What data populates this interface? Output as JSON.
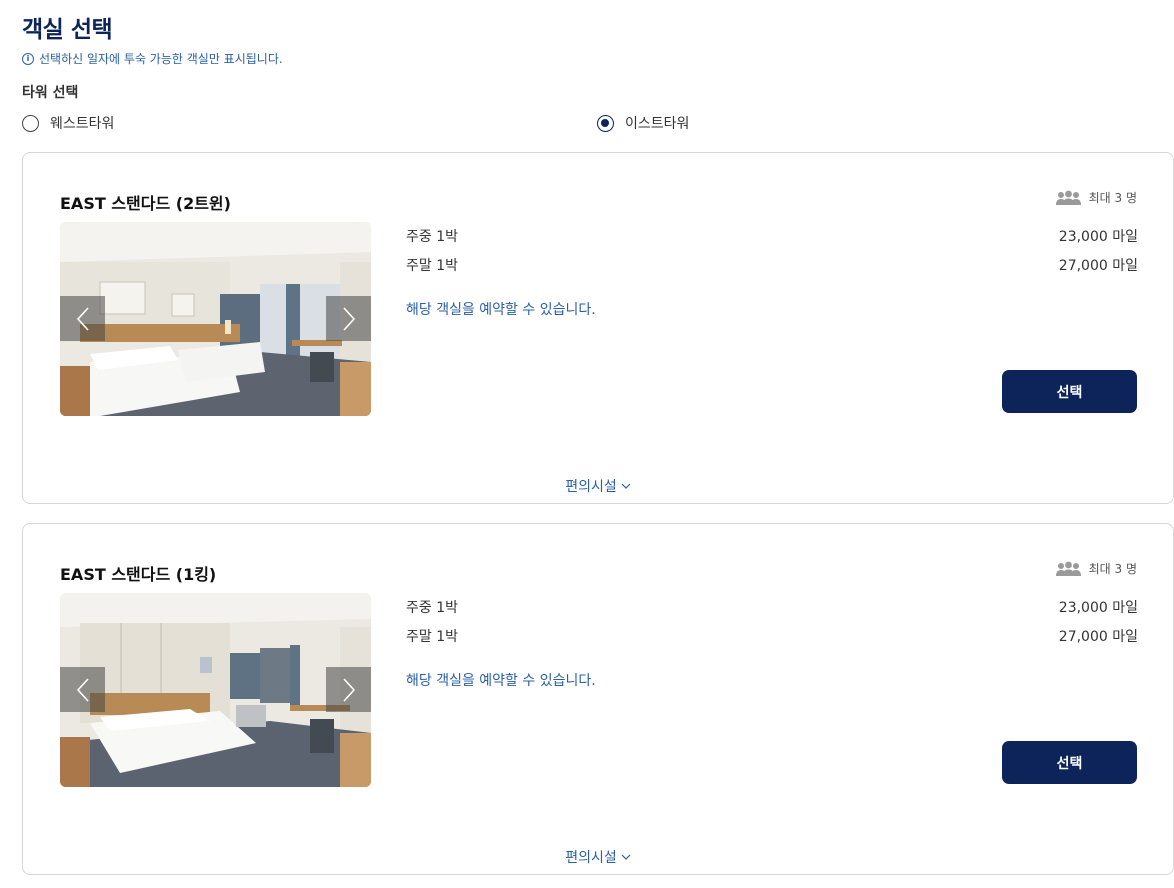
{
  "page": {
    "title": "객실 선택",
    "notice": "선택하신 일자에 투숙 가능한 객실만 표시됩니다.",
    "tower_label": "타워 선택",
    "info_icon_glyph": "i"
  },
  "towers": [
    {
      "label": "웨스트타워",
      "selected": false
    },
    {
      "label": "이스트타워",
      "selected": true
    }
  ],
  "rooms": [
    {
      "name": "EAST 스탠다드 (2트윈)",
      "capacity": "최대 3 명",
      "weekday_label": "주중 1박",
      "weekday_price": "23,000 마일",
      "weekend_label": "주말 1박",
      "weekend_price": "27,000 마일",
      "availability": "해당 객실을 예약할 수 있습니다.",
      "select_label": "선택",
      "amenities_label": "편의시설",
      "image": "twin-bed-hotel-room-photo"
    },
    {
      "name": "EAST 스탠다드 (1킹)",
      "capacity": "최대 3 명",
      "weekday_label": "주중 1박",
      "weekday_price": "23,000 마일",
      "weekend_label": "주말 1박",
      "weekend_price": "27,000 마일",
      "availability": "해당 객실을 예약할 수 있습니다.",
      "select_label": "선택",
      "amenities_label": "편의시설",
      "image": "king-bed-hotel-room-photo"
    }
  ],
  "icons": {
    "info": "info-circle-icon",
    "capacity": "people-group-icon",
    "prev": "chevron-left-icon",
    "next": "chevron-right-icon",
    "expand": "chevron-down-icon"
  },
  "colors": {
    "brand_navy": "#0c2459",
    "link_blue": "#2a5fa8",
    "card_border": "#d6d6d6"
  }
}
